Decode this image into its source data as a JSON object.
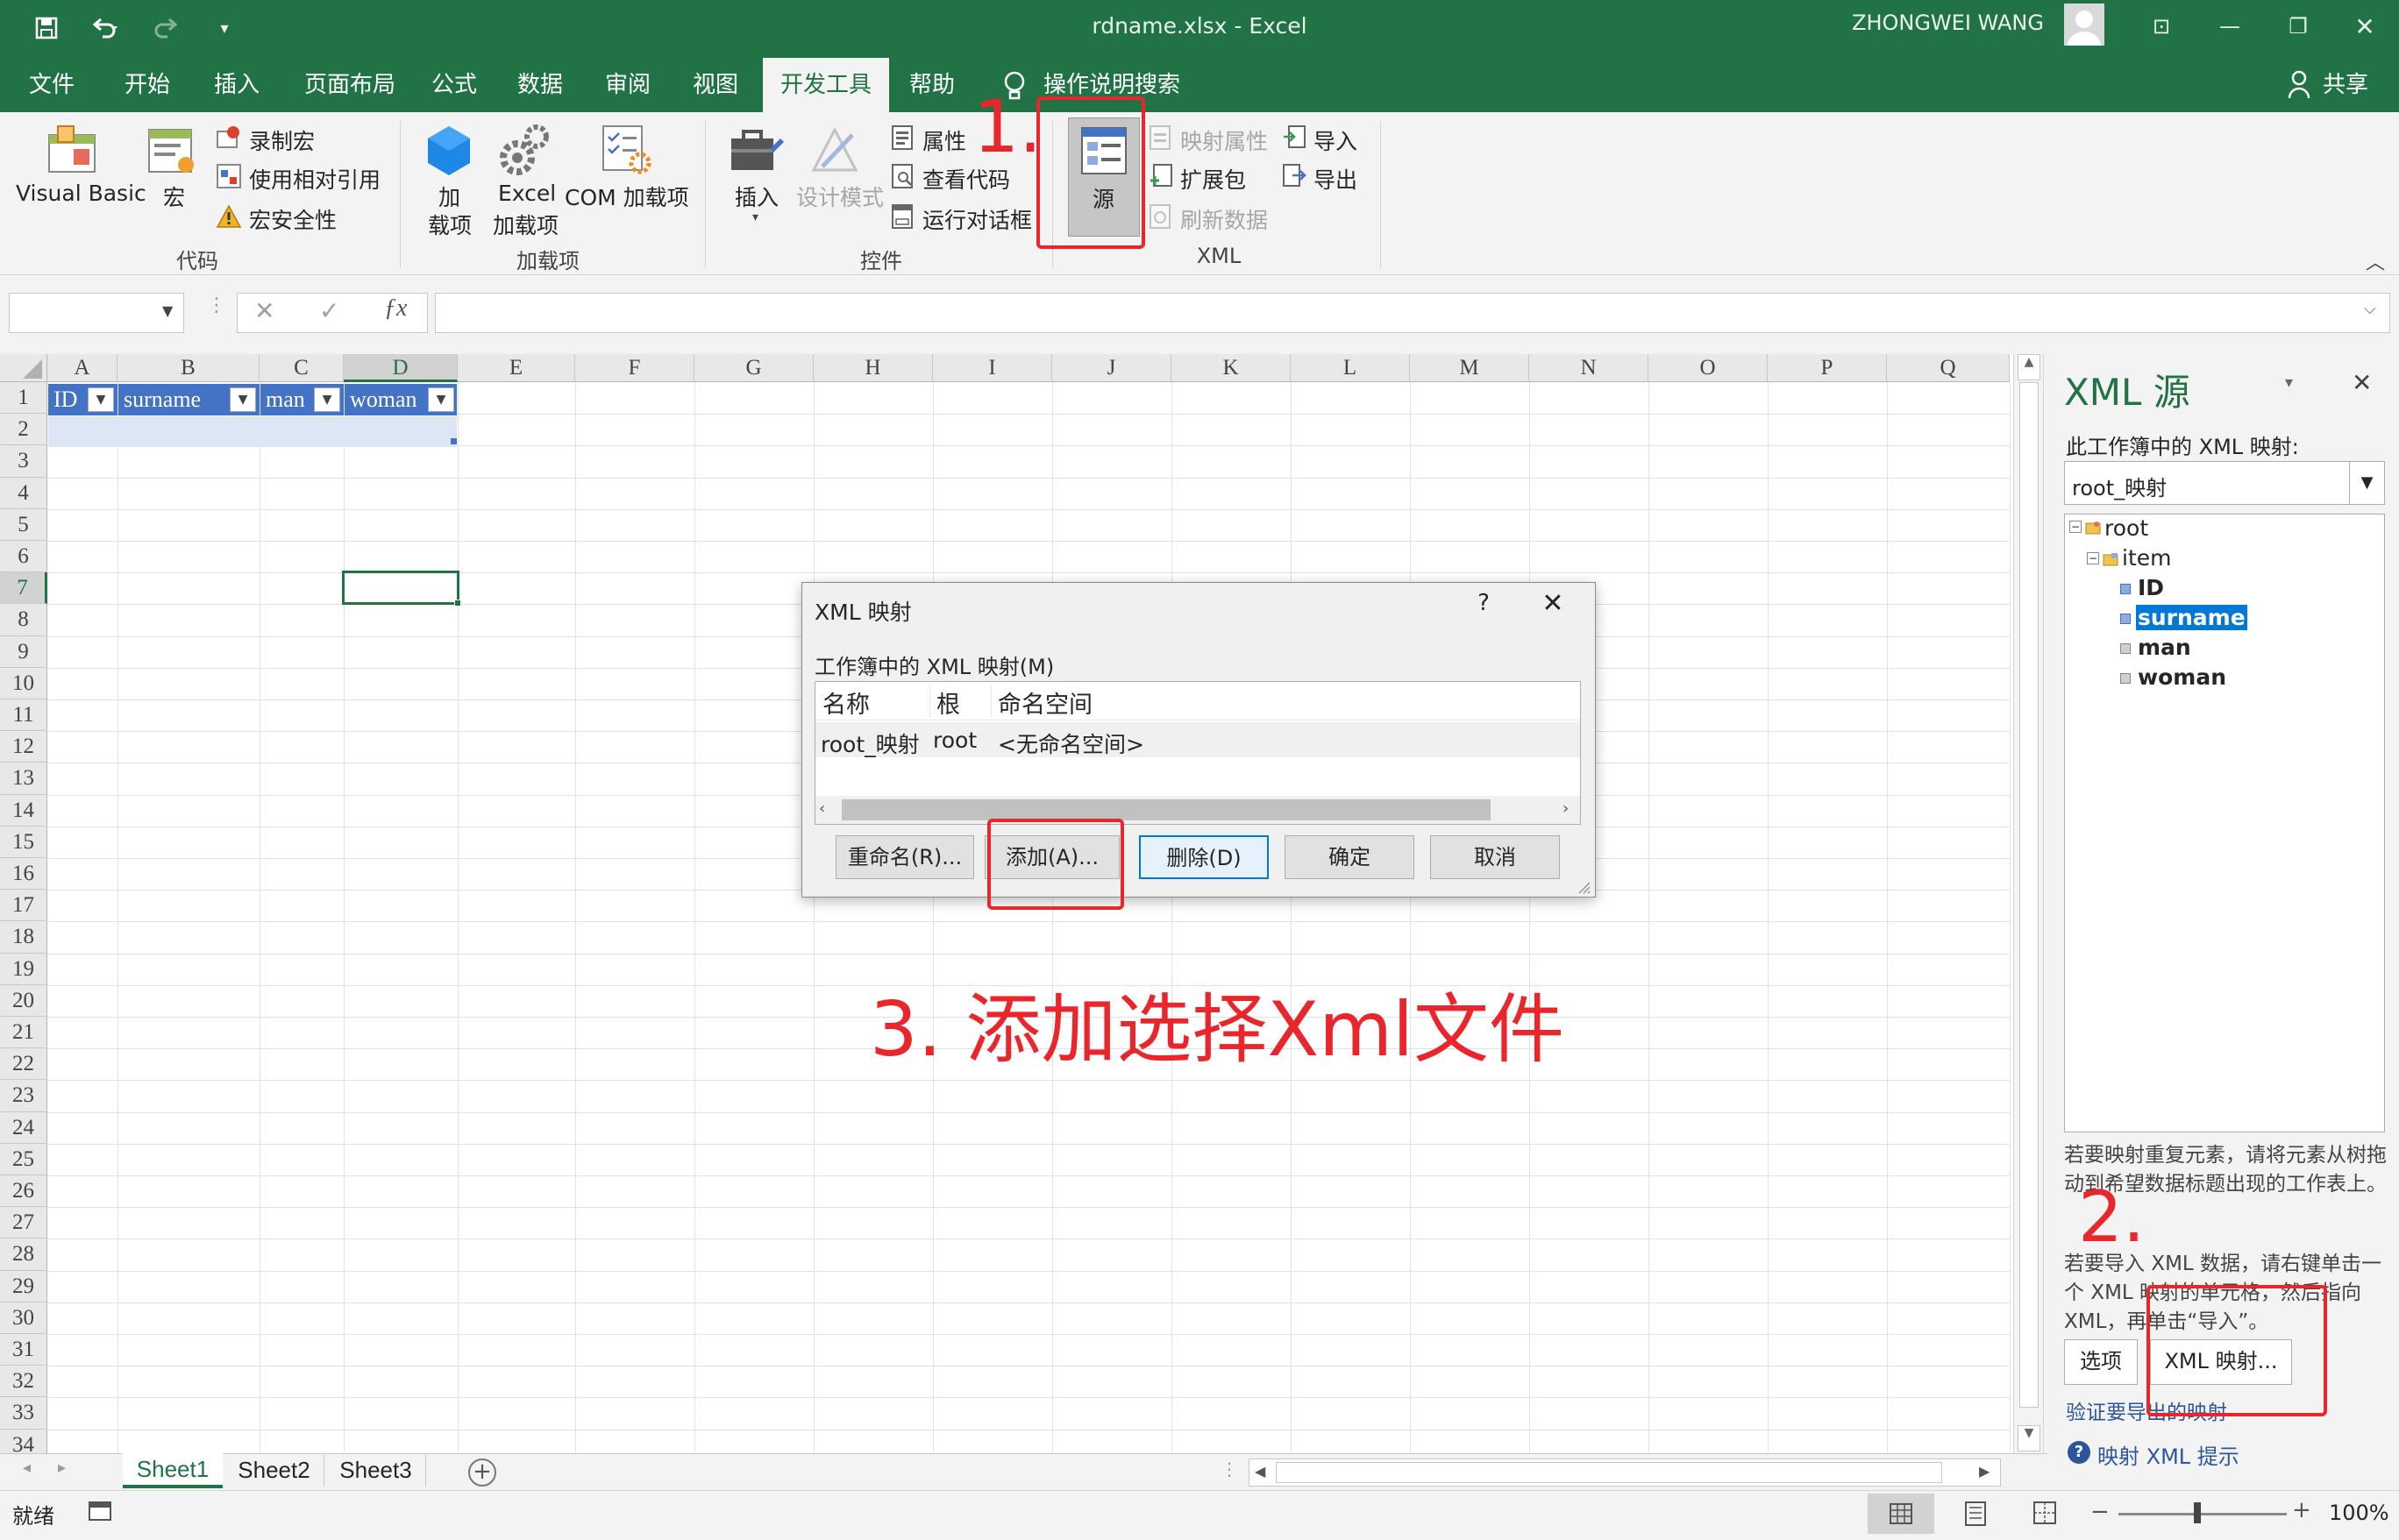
{
  "window": {
    "title": "rdname.xlsx  -  Excel",
    "user": "ZHONGWEI WANG",
    "share": "共享"
  },
  "tabs": [
    "文件",
    "开始",
    "插入",
    "页面布局",
    "公式",
    "数据",
    "审阅",
    "视图",
    "开发工具",
    "帮助",
    "操作说明搜索"
  ],
  "ribbon": {
    "code": {
      "visual_basic": "Visual Basic",
      "macro": "宏",
      "record": "录制宏",
      "relative": "使用相对引用",
      "security": "宏安全性",
      "group": "代码"
    },
    "addins": {
      "addin_line1": "加",
      "addin_line2": "载项",
      "excel_line1": "Excel",
      "excel_line2": "加载项",
      "com": "COM 加载项",
      "group": "加载项"
    },
    "controls": {
      "insert": "插入",
      "design": "设计模式",
      "properties": "属性",
      "view_code": "查看代码",
      "run_dialog": "运行对话框",
      "group": "控件"
    },
    "xml": {
      "source": "源",
      "map_props": "映射属性",
      "expansion": "扩展包",
      "refresh": "刷新数据",
      "import": "导入",
      "export": "导出",
      "group": "XML"
    }
  },
  "formula_bar": {
    "name_box": "",
    "formula": ""
  },
  "grid": {
    "columns": [
      "A",
      "B",
      "C",
      "D",
      "E",
      "F",
      "G",
      "H",
      "I",
      "J",
      "K",
      "L",
      "M",
      "N",
      "O",
      "P",
      "Q"
    ],
    "rows": [
      "1",
      "2",
      "3",
      "4",
      "5",
      "6",
      "7",
      "8",
      "9",
      "10",
      "11",
      "12",
      "13",
      "14",
      "15",
      "16",
      "17",
      "18",
      "19",
      "20",
      "21",
      "22",
      "23",
      "24",
      "25",
      "26",
      "27",
      "28",
      "29",
      "30",
      "31",
      "32",
      "33",
      "34"
    ],
    "headers": [
      "ID",
      "surname",
      "man",
      "woman"
    ]
  },
  "dialog": {
    "title": "XML 映射",
    "help": "?",
    "close": "✕",
    "section": "工作簿中的 XML 映射(M)",
    "columns": [
      "名称",
      "根",
      "命名空间"
    ],
    "row": [
      "root_映射",
      "root",
      "<无命名空间>"
    ],
    "buttons": {
      "rename": "重命名(R)...",
      "add": "添加(A)...",
      "delete": "删除(D)",
      "ok": "确定",
      "cancel": "取消"
    }
  },
  "panel": {
    "title": "XML 源",
    "maps_label": "此工作簿中的 XML 映射:",
    "selected_map": "root_映射",
    "tree": {
      "root": "root",
      "item": "item",
      "fields": [
        "ID",
        "surname",
        "man",
        "woman"
      ]
    },
    "help1": "若要映射重复元素，请将元素从树拖动到希望数据标题出现的工作表上。",
    "help2": "若要导入 XML 数据，请右键单击一个 XML 映射的单元格，然后指向 XML，再单击“导入”。",
    "options_btn": "选项",
    "xml_maps_btn": "XML 映射...",
    "verify_link": "验证要导出的映射",
    "help_link": "映射 XML 提示"
  },
  "sheets": [
    "Sheet1",
    "Sheet2",
    "Sheet3"
  ],
  "status": {
    "ready": "就绪",
    "zoom": "100%"
  },
  "annotations": {
    "step1": "1.",
    "step2": "2.",
    "step3": "3. 添加选择Xml文件"
  },
  "colors": {
    "excel_green": "#217346",
    "table_header": "#4472c4",
    "annotation_red": "#e8262b"
  }
}
